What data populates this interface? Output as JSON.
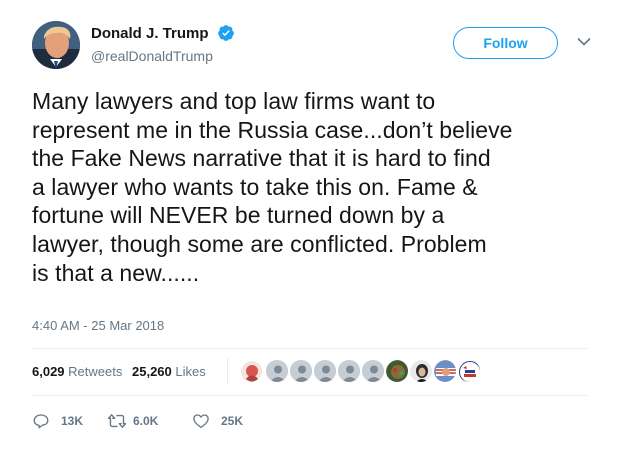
{
  "user": {
    "display_name": "Donald J. Trump",
    "handle": "@realDonaldTrump",
    "verified": true
  },
  "follow_button": {
    "label": "Follow"
  },
  "tweet": {
    "text_lines": [
      "Many lawyers and top law firms want to",
      "represent me in the Russia case...don’t believe",
      "the Fake News narrative that it is hard to find",
      "a lawyer who wants to take this on. Fame &",
      "fortune will NEVER be turned down by a",
      "lawyer, though some are conflicted. Problem",
      "is that a new......"
    ],
    "timestamp": "4:40 AM - 25 Mar 2018"
  },
  "stats": {
    "retweets_count": "6,029",
    "retweets_label": "Retweets",
    "likes_count": "25,260",
    "likes_label": "Likes"
  },
  "actions": {
    "reply_count": "13K",
    "retweet_count": "6.0K",
    "like_count": "25K"
  },
  "colors": {
    "accent": "#1da1f2",
    "muted": "#657786",
    "text": "#14171a",
    "divider": "#e6ecf0"
  }
}
